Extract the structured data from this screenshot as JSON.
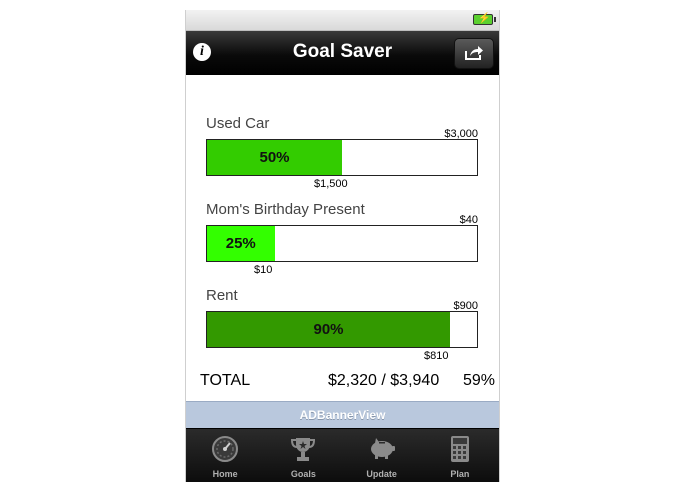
{
  "nav": {
    "title": "Goal Saver",
    "info_label": "i"
  },
  "goals": [
    {
      "name": "Used Car",
      "target": "$3,000",
      "saved": "$1,500",
      "percent_label": "50%",
      "progress": 0.5,
      "color": "#33cc00"
    },
    {
      "name": "Mom's Birthday Present",
      "target": "$40",
      "saved": "$10",
      "percent_label": "25%",
      "progress": 0.25,
      "color": "#33ff00"
    },
    {
      "name": "Rent",
      "target": "$900",
      "saved": "$810",
      "percent_label": "90%",
      "progress": 0.9,
      "color": "#339900"
    }
  ],
  "total": {
    "label": "TOTAL",
    "value": "$2,320 / $3,940",
    "percent": "59%"
  },
  "ad": {
    "text": "ADBannerView"
  },
  "tabs": [
    {
      "label": "Home",
      "icon": "gauge-icon"
    },
    {
      "label": "Goals",
      "icon": "trophy-icon"
    },
    {
      "label": "Update",
      "icon": "piggy-bank-icon"
    },
    {
      "label": "Plan",
      "icon": "calculator-icon"
    }
  ]
}
